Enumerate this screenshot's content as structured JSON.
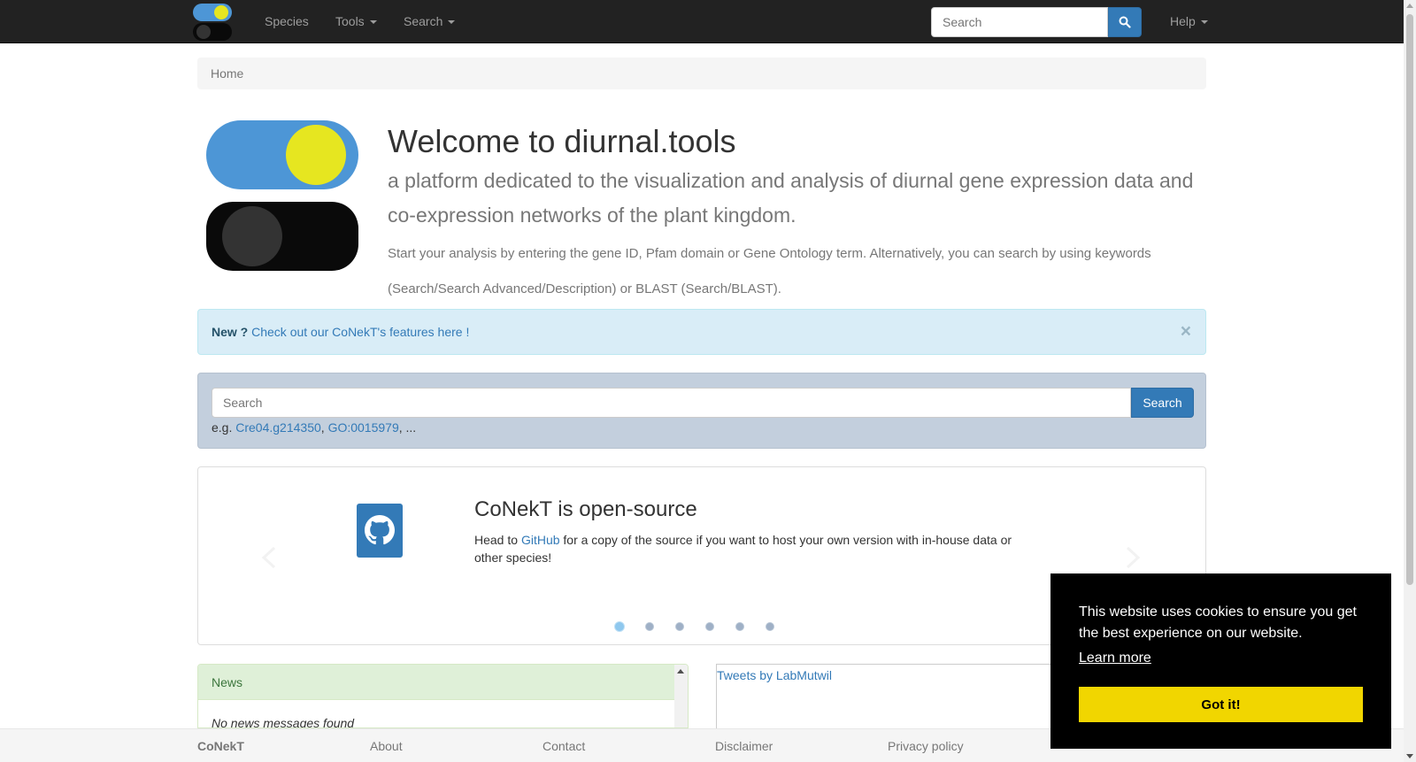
{
  "navbar": {
    "logo_icon": "diurnal-toggle-logo-icon",
    "items": [
      {
        "label": "Species",
        "dropdown": false
      },
      {
        "label": "Tools",
        "dropdown": true
      },
      {
        "label": "Search",
        "dropdown": true
      }
    ],
    "search_placeholder": "Search",
    "search_icon": "search-icon",
    "help_label": "Help"
  },
  "breadcrumb": {
    "label": "Home"
  },
  "hero": {
    "title": "Welcome to diurnal.tools",
    "subtitle": "a platform dedicated to the visualization and analysis of diurnal gene expression data and co-expression networks of the plant kingdom.",
    "text": "Start your analysis by entering the gene ID, Pfam domain or Gene Ontology term. Alternatively, you can search by using keywords (Search/Search Advanced/Description) or BLAST (Search/BLAST)."
  },
  "alert": {
    "bold": "New ?",
    "link": "Check out our CoNekT's features here !",
    "close": "×"
  },
  "main_search": {
    "placeholder": "Search",
    "button": "Search",
    "eg_prefix": "e.g.",
    "example1": "Cre04.g214350",
    "example2": "GO:0015979",
    "ellipsis": "..."
  },
  "carousel": {
    "icon": "github-icon",
    "title": "CoNekT is open-source",
    "text_before": "Head to",
    "link": "GitHub",
    "text_after": "for a copy of the source if you want to host your own version with in-house data or other species!",
    "slide_count": 6,
    "active_slide": 1
  },
  "news": {
    "heading": "News",
    "empty": "No news messages found"
  },
  "tweets": {
    "link": "Tweets by LabMutwil"
  },
  "footer": {
    "brand": "CoNekT",
    "about": "About",
    "contact": "Contact",
    "disclaimer": "Disclaimer",
    "privacy": "Privacy policy"
  },
  "cookie": {
    "message": "This website uses cookies to ensure you get the best experience on our website.",
    "learn_more": "Learn more",
    "button": "Got it!"
  },
  "colors": {
    "navbar_bg": "#222222",
    "primary": "#337ab7",
    "logo_blue": "#4d96d6",
    "logo_yellow": "#e6e620",
    "cookie_button": "#f1d600"
  }
}
